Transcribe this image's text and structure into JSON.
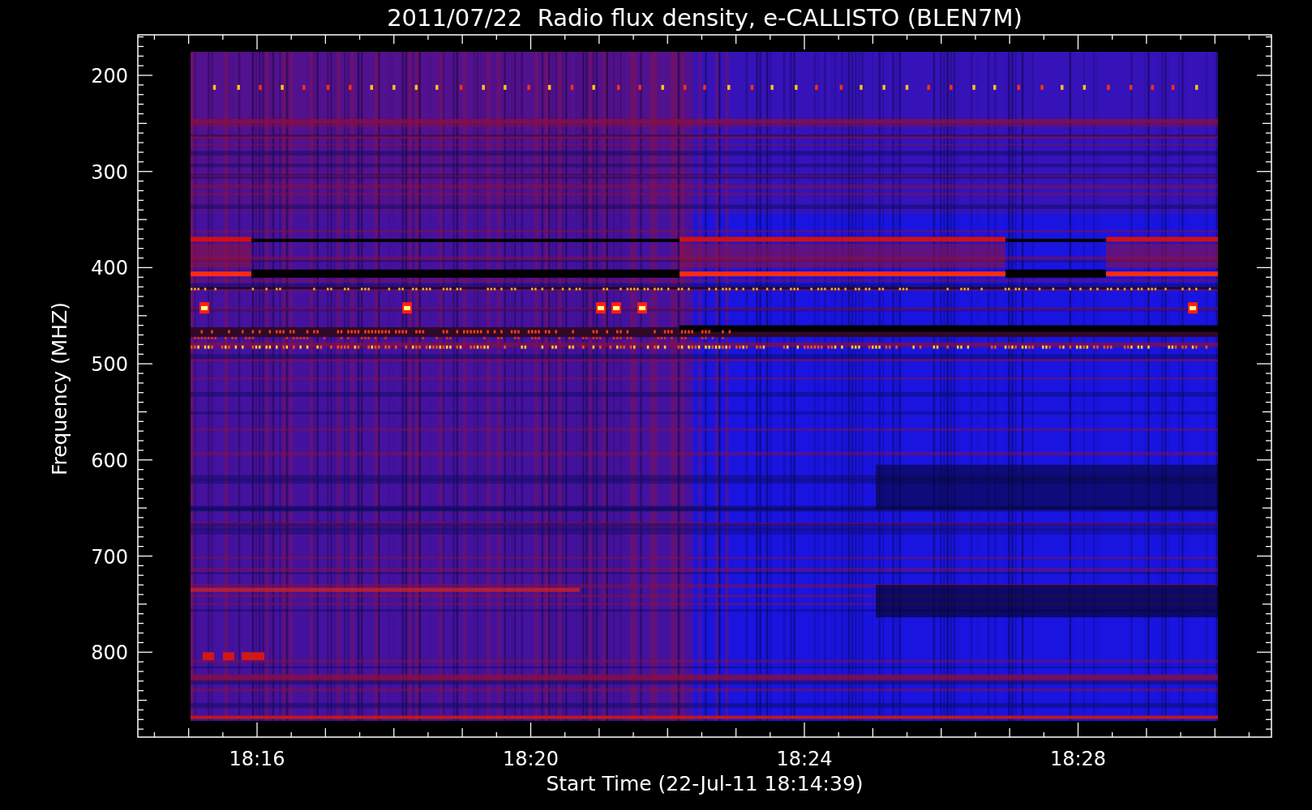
{
  "title": "2011/07/22  Radio flux density, e-CALLISTO (BLEN7M)",
  "plot": {
    "ylabel": "Frequency (MHZ)",
    "xlabel": "Start Time (22-Jul-11 18:14:39)",
    "yticks": [
      "200",
      "300",
      "400",
      "500",
      "600",
      "700",
      "800"
    ],
    "xticks": [
      "18:16",
      "18:20",
      "18:24",
      "18:28"
    ]
  }
}
